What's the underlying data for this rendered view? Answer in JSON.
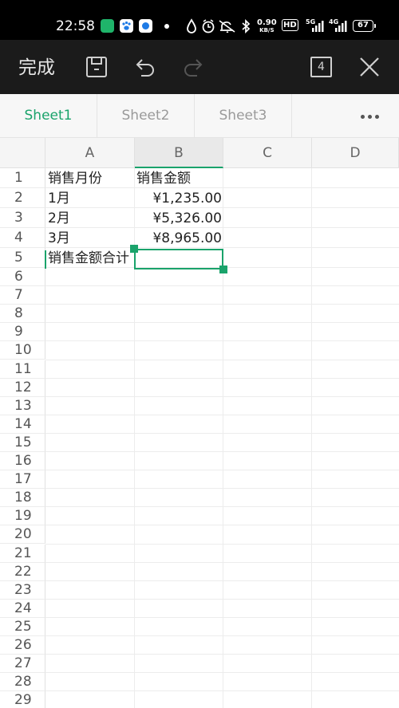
{
  "status_bar": {
    "time": "22:58",
    "net_speed": "0.90",
    "net_speed_unit": "KB/S",
    "hd_label": "HD",
    "sim1_label": "5G",
    "sim2_label": "4G",
    "battery": "67"
  },
  "toolbar": {
    "done_label": "完成",
    "sheet_count": "4"
  },
  "tabs": [
    {
      "label": "Sheet1",
      "active": true
    },
    {
      "label": "Sheet2",
      "active": false
    },
    {
      "label": "Sheet3",
      "active": false
    }
  ],
  "grid": {
    "columns": [
      "A",
      "B",
      "C",
      "D"
    ],
    "selected_column": "B",
    "rows": [
      "1",
      "2",
      "3",
      "4",
      "5",
      "6",
      "7",
      "8",
      "9",
      "10",
      "11",
      "12",
      "13",
      "14",
      "15",
      "16",
      "17",
      "18",
      "19",
      "20",
      "21",
      "22",
      "23",
      "24",
      "25",
      "26",
      "27",
      "28",
      "29"
    ],
    "cells": {
      "A1": "销售月份",
      "B1": "销售金额",
      "A2": "1月",
      "B2": "¥1,235.00",
      "A3": "2月",
      "B3": "¥5,326.00",
      "A4": "3月",
      "B4": "¥8,965.00",
      "A5": "销售金额合计"
    },
    "selected_cell": "B5"
  },
  "colors": {
    "accent": "#1aa36b",
    "toolbar_bg": "#1b1b1b"
  }
}
